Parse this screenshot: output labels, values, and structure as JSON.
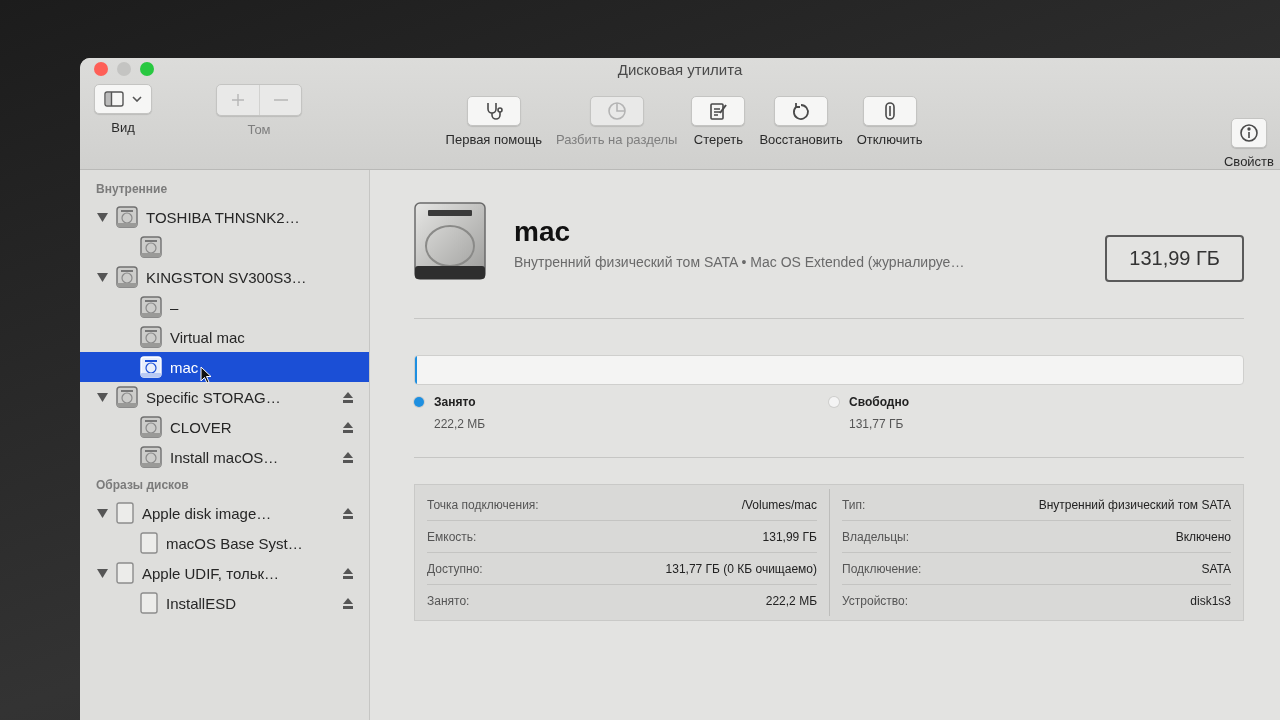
{
  "window": {
    "title": "Дисковая утилита",
    "controls": [
      {
        "kind": "close",
        "disabled": false
      },
      {
        "kind": "minimize",
        "disabled": true
      },
      {
        "kind": "zoom",
        "disabled": false
      }
    ]
  },
  "toolbar": {
    "view": {
      "label": "Вид"
    },
    "volume": {
      "label": "Том",
      "disabled": true
    },
    "actions": [
      {
        "kind": "first_aid",
        "label": "Первая помощь",
        "disabled": false
      },
      {
        "kind": "partition",
        "label": "Разбить на разделы",
        "disabled": true
      },
      {
        "kind": "erase",
        "label": "Стереть",
        "disabled": false
      },
      {
        "kind": "restore",
        "label": "Восстановить",
        "disabled": false
      },
      {
        "kind": "unmount",
        "label": "Отключить",
        "disabled": false
      }
    ],
    "info": {
      "label": "Свойств"
    }
  },
  "sidebar": {
    "sections": [
      {
        "title": "Внутренние",
        "items": [
          {
            "label": "TOSHIBA THNSNK2…",
            "kind": "disk",
            "selected": false,
            "ejectable": false,
            "expanded": true,
            "children": [
              {
                "kind": "disk",
                "selected": false,
                "ejectable": false
              }
            ]
          },
          {
            "label": "KINGSTON SV300S3…",
            "kind": "disk",
            "selected": false,
            "ejectable": false,
            "expanded": true,
            "children": [
              {
                "label": "–",
                "kind": "disk",
                "selected": false,
                "ejectable": false
              },
              {
                "label": "Virtual mac",
                "kind": "disk",
                "selected": false,
                "ejectable": false
              },
              {
                "label": "mac",
                "kind": "disk",
                "selected": true,
                "ejectable": false
              }
            ]
          },
          {
            "label": "Specific STORAG…",
            "kind": "disk",
            "selected": false,
            "ejectable": true,
            "expanded": true,
            "children": [
              {
                "label": "CLOVER",
                "kind": "disk",
                "selected": false,
                "ejectable": true
              },
              {
                "label": "Install macOS…",
                "kind": "disk",
                "selected": false,
                "ejectable": true
              }
            ]
          }
        ]
      },
      {
        "title": "Образы дисков",
        "items": [
          {
            "label": "Apple disk image…",
            "kind": "image",
            "selected": false,
            "ejectable": true,
            "expanded": true,
            "children": [
              {
                "label": "macOS Base Syst…",
                "kind": "image",
                "selected": false,
                "ejectable": false
              }
            ]
          },
          {
            "label": "Apple UDIF, тольк…",
            "kind": "image",
            "selected": false,
            "ejectable": true,
            "expanded": true,
            "children": [
              {
                "label": "InstallESD",
                "kind": "image",
                "selected": false,
                "ejectable": true
              }
            ]
          }
        ]
      }
    ]
  },
  "volume": {
    "name": "mac",
    "description": "Внутренний физический том SATA • Mac OS Extended (журналируе…",
    "size": "131,99 ГБ"
  },
  "usage": {
    "level": 0.002,
    "legend": [
      {
        "label": "Занято",
        "value": "222,2 МБ",
        "color": "#1e8fe0"
      },
      {
        "label": "Свободно",
        "value": "131,77 ГБ",
        "color": "#f4f4f4"
      }
    ]
  },
  "details": {
    "left": [
      {
        "label": "Точка подключения:",
        "value": "/Volumes/mac"
      },
      {
        "label": "Емкость:",
        "value": "131,99 ГБ"
      },
      {
        "label": "Доступно:",
        "value": "131,77 ГБ (0 КБ очищаемо)"
      },
      {
        "label": "Занято:",
        "value": "222,2 МБ"
      }
    ],
    "right": [
      {
        "label": "Тип:",
        "value": "Внутренний физический том SATA"
      },
      {
        "label": "Владельцы:",
        "value": "Включено"
      },
      {
        "label": "Подключение:",
        "value": "SATA"
      },
      {
        "label": "Устройство:",
        "value": "disk1s3"
      }
    ]
  }
}
